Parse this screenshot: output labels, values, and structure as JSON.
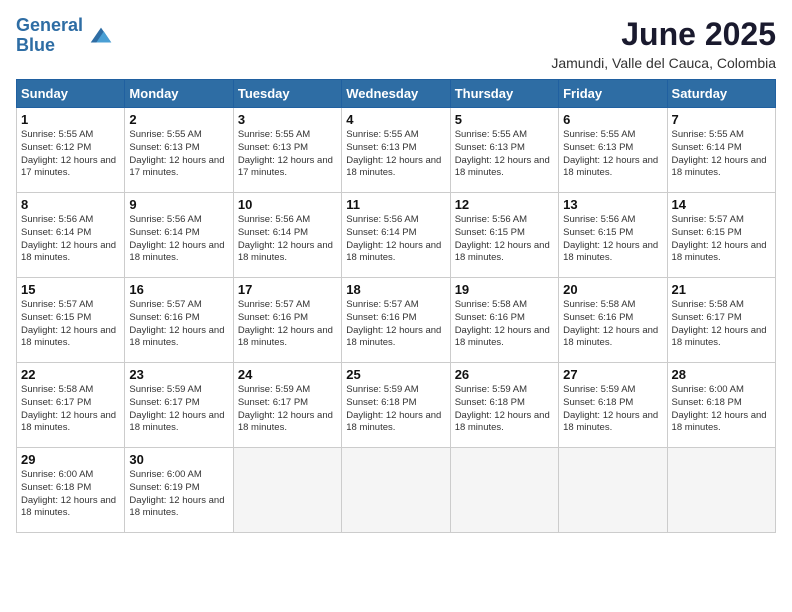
{
  "header": {
    "logo_line1": "General",
    "logo_line2": "Blue",
    "month_title": "June 2025",
    "subtitle": "Jamundi, Valle del Cauca, Colombia"
  },
  "weekdays": [
    "Sunday",
    "Monday",
    "Tuesday",
    "Wednesday",
    "Thursday",
    "Friday",
    "Saturday"
  ],
  "weeks": [
    [
      {
        "day": "1",
        "sunrise": "Sunrise: 5:55 AM",
        "sunset": "Sunset: 6:12 PM",
        "daylight": "Daylight: 12 hours and 17 minutes."
      },
      {
        "day": "2",
        "sunrise": "Sunrise: 5:55 AM",
        "sunset": "Sunset: 6:13 PM",
        "daylight": "Daylight: 12 hours and 17 minutes."
      },
      {
        "day": "3",
        "sunrise": "Sunrise: 5:55 AM",
        "sunset": "Sunset: 6:13 PM",
        "daylight": "Daylight: 12 hours and 17 minutes."
      },
      {
        "day": "4",
        "sunrise": "Sunrise: 5:55 AM",
        "sunset": "Sunset: 6:13 PM",
        "daylight": "Daylight: 12 hours and 18 minutes."
      },
      {
        "day": "5",
        "sunrise": "Sunrise: 5:55 AM",
        "sunset": "Sunset: 6:13 PM",
        "daylight": "Daylight: 12 hours and 18 minutes."
      },
      {
        "day": "6",
        "sunrise": "Sunrise: 5:55 AM",
        "sunset": "Sunset: 6:13 PM",
        "daylight": "Daylight: 12 hours and 18 minutes."
      },
      {
        "day": "7",
        "sunrise": "Sunrise: 5:55 AM",
        "sunset": "Sunset: 6:14 PM",
        "daylight": "Daylight: 12 hours and 18 minutes."
      }
    ],
    [
      {
        "day": "8",
        "sunrise": "Sunrise: 5:56 AM",
        "sunset": "Sunset: 6:14 PM",
        "daylight": "Daylight: 12 hours and 18 minutes."
      },
      {
        "day": "9",
        "sunrise": "Sunrise: 5:56 AM",
        "sunset": "Sunset: 6:14 PM",
        "daylight": "Daylight: 12 hours and 18 minutes."
      },
      {
        "day": "10",
        "sunrise": "Sunrise: 5:56 AM",
        "sunset": "Sunset: 6:14 PM",
        "daylight": "Daylight: 12 hours and 18 minutes."
      },
      {
        "day": "11",
        "sunrise": "Sunrise: 5:56 AM",
        "sunset": "Sunset: 6:14 PM",
        "daylight": "Daylight: 12 hours and 18 minutes."
      },
      {
        "day": "12",
        "sunrise": "Sunrise: 5:56 AM",
        "sunset": "Sunset: 6:15 PM",
        "daylight": "Daylight: 12 hours and 18 minutes."
      },
      {
        "day": "13",
        "sunrise": "Sunrise: 5:56 AM",
        "sunset": "Sunset: 6:15 PM",
        "daylight": "Daylight: 12 hours and 18 minutes."
      },
      {
        "day": "14",
        "sunrise": "Sunrise: 5:57 AM",
        "sunset": "Sunset: 6:15 PM",
        "daylight": "Daylight: 12 hours and 18 minutes."
      }
    ],
    [
      {
        "day": "15",
        "sunrise": "Sunrise: 5:57 AM",
        "sunset": "Sunset: 6:15 PM",
        "daylight": "Daylight: 12 hours and 18 minutes."
      },
      {
        "day": "16",
        "sunrise": "Sunrise: 5:57 AM",
        "sunset": "Sunset: 6:16 PM",
        "daylight": "Daylight: 12 hours and 18 minutes."
      },
      {
        "day": "17",
        "sunrise": "Sunrise: 5:57 AM",
        "sunset": "Sunset: 6:16 PM",
        "daylight": "Daylight: 12 hours and 18 minutes."
      },
      {
        "day": "18",
        "sunrise": "Sunrise: 5:57 AM",
        "sunset": "Sunset: 6:16 PM",
        "daylight": "Daylight: 12 hours and 18 minutes."
      },
      {
        "day": "19",
        "sunrise": "Sunrise: 5:58 AM",
        "sunset": "Sunset: 6:16 PM",
        "daylight": "Daylight: 12 hours and 18 minutes."
      },
      {
        "day": "20",
        "sunrise": "Sunrise: 5:58 AM",
        "sunset": "Sunset: 6:16 PM",
        "daylight": "Daylight: 12 hours and 18 minutes."
      },
      {
        "day": "21",
        "sunrise": "Sunrise: 5:58 AM",
        "sunset": "Sunset: 6:17 PM",
        "daylight": "Daylight: 12 hours and 18 minutes."
      }
    ],
    [
      {
        "day": "22",
        "sunrise": "Sunrise: 5:58 AM",
        "sunset": "Sunset: 6:17 PM",
        "daylight": "Daylight: 12 hours and 18 minutes."
      },
      {
        "day": "23",
        "sunrise": "Sunrise: 5:59 AM",
        "sunset": "Sunset: 6:17 PM",
        "daylight": "Daylight: 12 hours and 18 minutes."
      },
      {
        "day": "24",
        "sunrise": "Sunrise: 5:59 AM",
        "sunset": "Sunset: 6:17 PM",
        "daylight": "Daylight: 12 hours and 18 minutes."
      },
      {
        "day": "25",
        "sunrise": "Sunrise: 5:59 AM",
        "sunset": "Sunset: 6:18 PM",
        "daylight": "Daylight: 12 hours and 18 minutes."
      },
      {
        "day": "26",
        "sunrise": "Sunrise: 5:59 AM",
        "sunset": "Sunset: 6:18 PM",
        "daylight": "Daylight: 12 hours and 18 minutes."
      },
      {
        "day": "27",
        "sunrise": "Sunrise: 5:59 AM",
        "sunset": "Sunset: 6:18 PM",
        "daylight": "Daylight: 12 hours and 18 minutes."
      },
      {
        "day": "28",
        "sunrise": "Sunrise: 6:00 AM",
        "sunset": "Sunset: 6:18 PM",
        "daylight": "Daylight: 12 hours and 18 minutes."
      }
    ],
    [
      {
        "day": "29",
        "sunrise": "Sunrise: 6:00 AM",
        "sunset": "Sunset: 6:18 PM",
        "daylight": "Daylight: 12 hours and 18 minutes."
      },
      {
        "day": "30",
        "sunrise": "Sunrise: 6:00 AM",
        "sunset": "Sunset: 6:19 PM",
        "daylight": "Daylight: 12 hours and 18 minutes."
      },
      null,
      null,
      null,
      null,
      null
    ]
  ]
}
